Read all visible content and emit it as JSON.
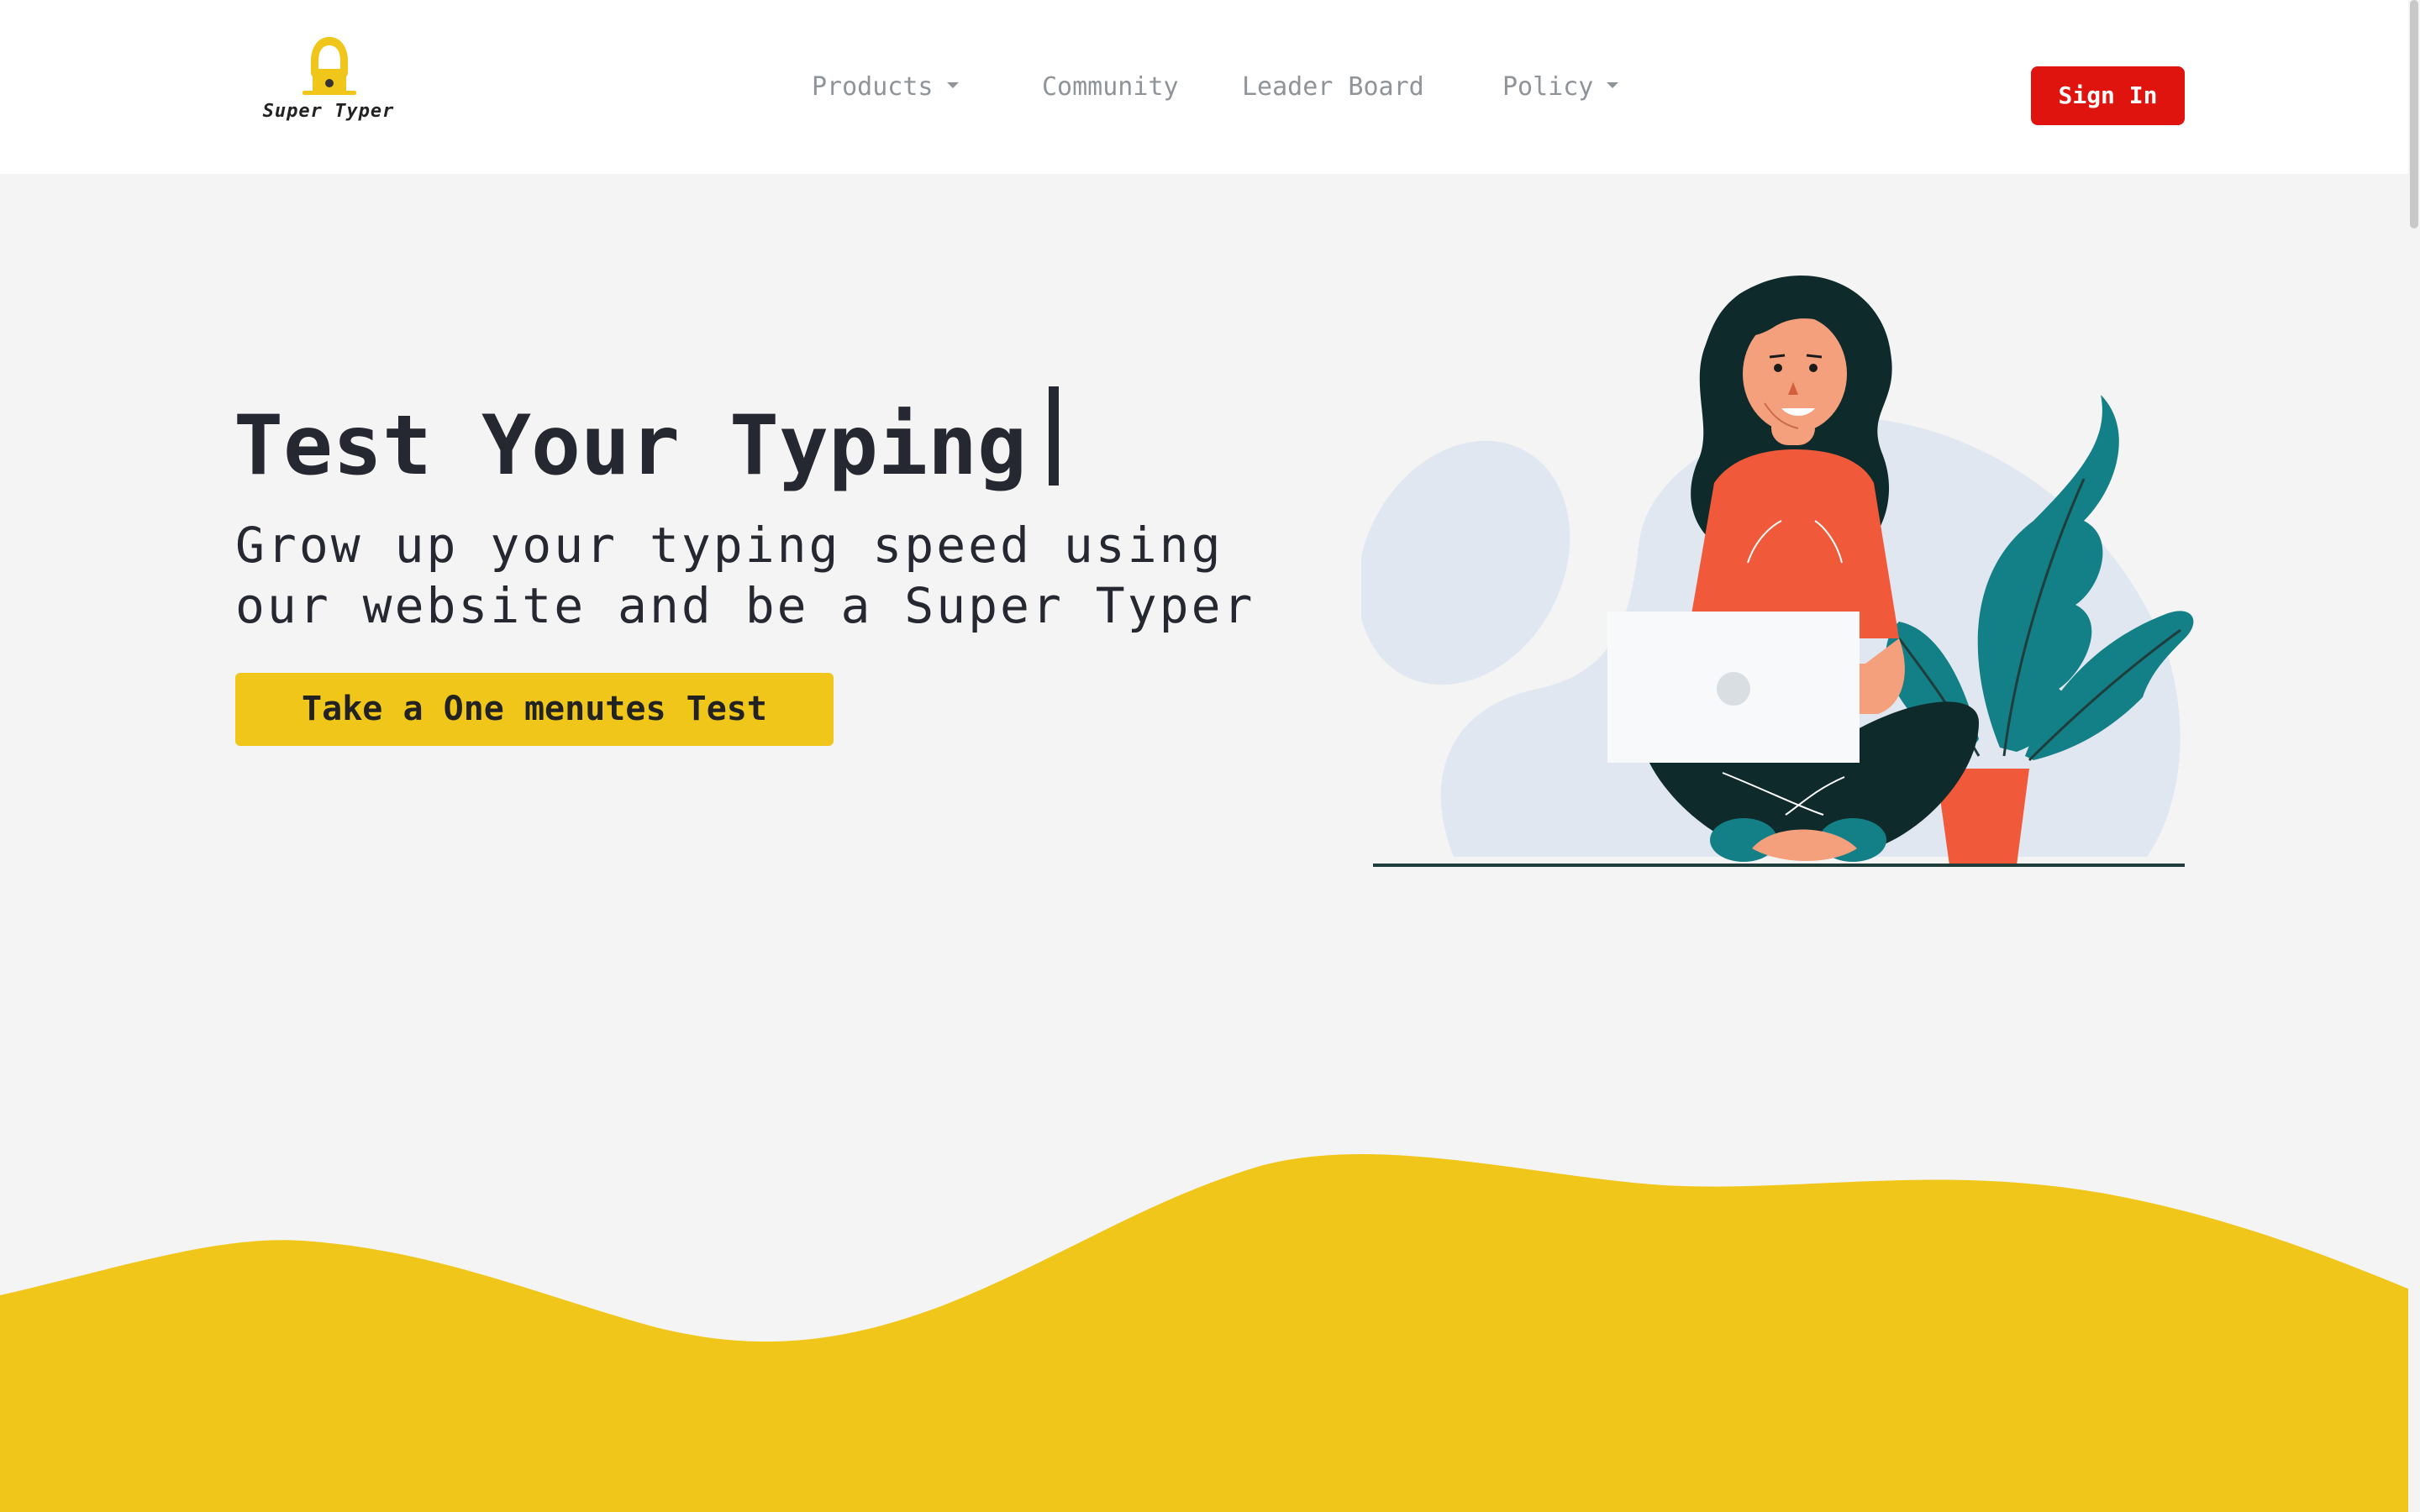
{
  "brand": {
    "name": "Super Typer",
    "logo_icon": "hooded-hacker-laptop-icon"
  },
  "nav": {
    "items": [
      {
        "label": "Products",
        "has_dropdown": true
      },
      {
        "label": "Community",
        "has_dropdown": false
      },
      {
        "label": "Leader Board",
        "has_dropdown": false
      },
      {
        "label": "Policy",
        "has_dropdown": true
      }
    ],
    "signin_label": "Sign In"
  },
  "hero": {
    "title": "Test Your Typing",
    "subtitle": "Grow up your typing speed using our website and be a Super Typer",
    "cta_label": "Take a One menutes Test",
    "illustration": "woman-sitting-with-laptop-and-plant-illustration"
  },
  "colors": {
    "accent_yellow": "#f1c61b",
    "signin_red": "#e0140e",
    "nav_text": "#8f9499",
    "heading_text": "#252830",
    "page_background": "#f4f4f4",
    "navbar_background": "#ffffff"
  }
}
